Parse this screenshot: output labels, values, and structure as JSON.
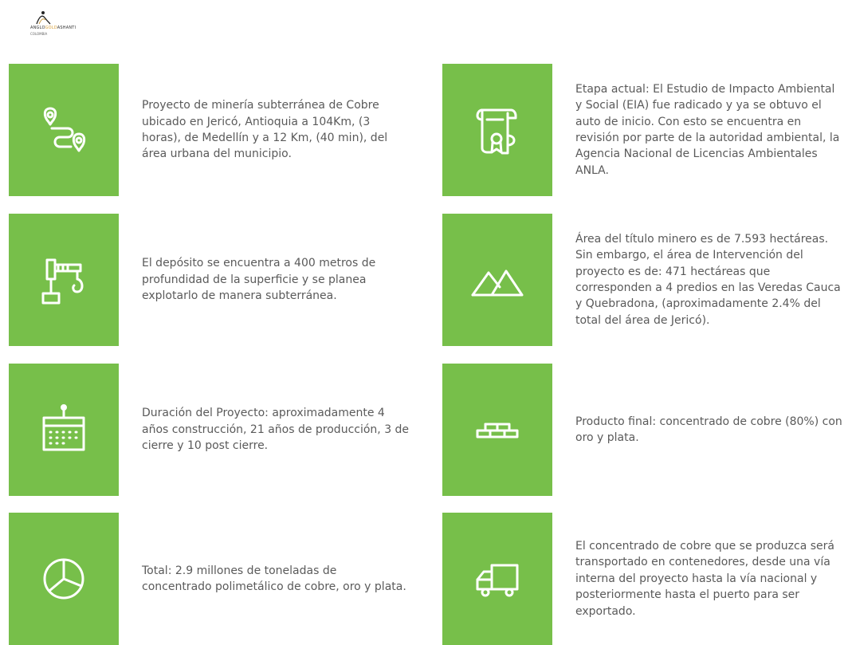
{
  "logo": {
    "brand_part1": "ANGLO",
    "brand_part2": "GOLD",
    "brand_part3": "ASHANTI",
    "country": "COLOMBIA"
  },
  "colors": {
    "tile_green": "#77bf4a",
    "text_gray": "#5a5a5a",
    "icon_white": "#ffffff"
  },
  "cards": [
    {
      "icon": "route-pins-icon",
      "text": "Proyecto de minería subterránea de Cobre ubicado en Jericó, Antioquia a 104Km, (3 horas), de Medellín y a 12 Km, (40 min), del área urbana del municipio."
    },
    {
      "icon": "certificate-scroll-icon",
      "text": "Etapa actual: El Estudio de Impacto Ambiental y Social (EIA) fue radicado y ya se obtuvo el auto de inicio. Con esto se encuentra en revisión por parte de la autoridad ambiental, la Agencia Nacional de Licencias Ambientales ANLA."
    },
    {
      "icon": "crane-icon",
      "text": "El depósito se encuentra a 400 metros de profundidad de la superficie y se planea explotarlo de manera subterránea."
    },
    {
      "icon": "mountains-icon",
      "text": "Área del título minero es de 7.593 hectáreas. Sin embargo, el área de Intervención del proyecto es de: 471 hectáreas que corresponden a 4 predios en las Veredas Cauca y Quebradona, (aproximadamente 2.4% del total del área de Jericó)."
    },
    {
      "icon": "calendar-icon",
      "text": "Duración del Proyecto: aproximadamente 4 años construcción, 21 años de producción, 3 de cierre y 10 post cierre."
    },
    {
      "icon": "bricks-icon",
      "text": "Producto final: concentrado de cobre (80%) con oro y plata."
    },
    {
      "icon": "pie-chart-icon",
      "text": "Total: 2.9 millones de toneladas de concentrado polimetálico de cobre, oro y plata."
    },
    {
      "icon": "truck-icon",
      "text": "El concentrado de cobre que se produzca será transportado en contenedores, desde una vía interna del proyecto hasta la vía nacional y posteriormente hasta el puerto para ser exportado."
    }
  ]
}
